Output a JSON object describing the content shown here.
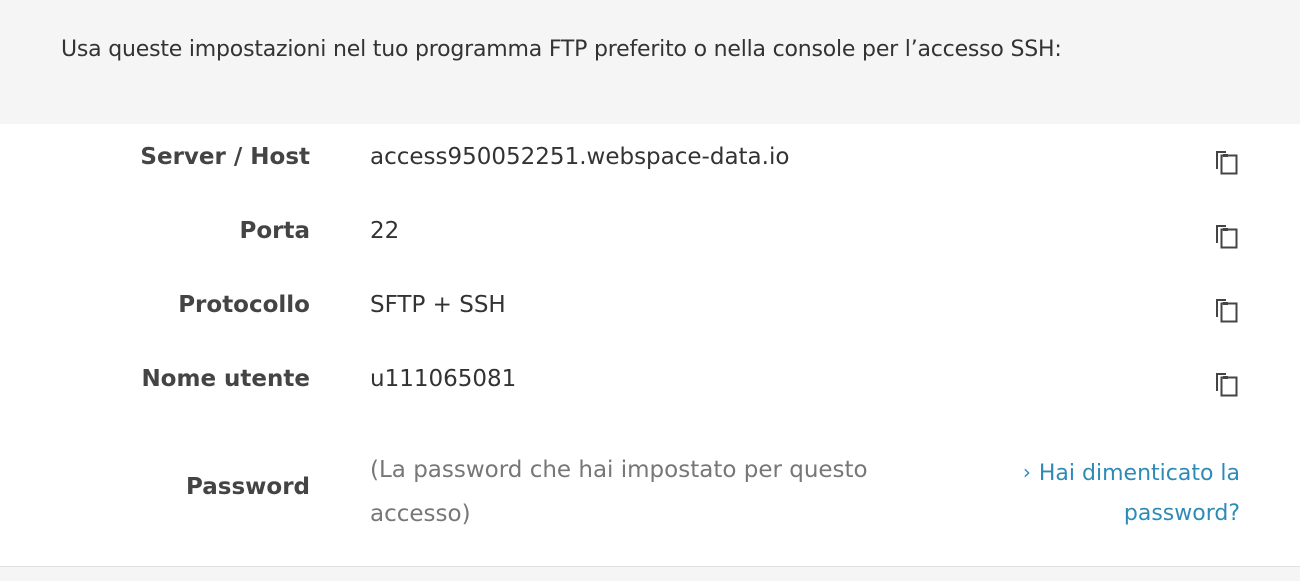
{
  "intro": {
    "text": "Usa queste impostazioni nel tuo programma FTP preferito o nella console per l’accesso SSH:"
  },
  "fields": [
    {
      "label": "Server / Host",
      "value": "access950052251.webspace-data.io",
      "icon": "copy-icon"
    },
    {
      "label": "Porta",
      "value": "22",
      "icon": "copy-icon"
    },
    {
      "label": "Protocollo",
      "value": "SFTP + SSH",
      "icon": "copy-icon"
    },
    {
      "label": "Nome utente",
      "value": "u111065081",
      "icon": "copy-icon"
    }
  ],
  "password": {
    "label": "Password",
    "hint": "(La password che hai impostato per questo accesso)",
    "forgot_link": "Hai dimenticato la password?",
    "link_icon": "chevron-right-icon"
  },
  "colors": {
    "intro_bg": "#f5f5f5",
    "label": "#444444",
    "value": "#333333",
    "hint": "#777777",
    "link": "#2e8bb8",
    "icon": "#444444"
  }
}
